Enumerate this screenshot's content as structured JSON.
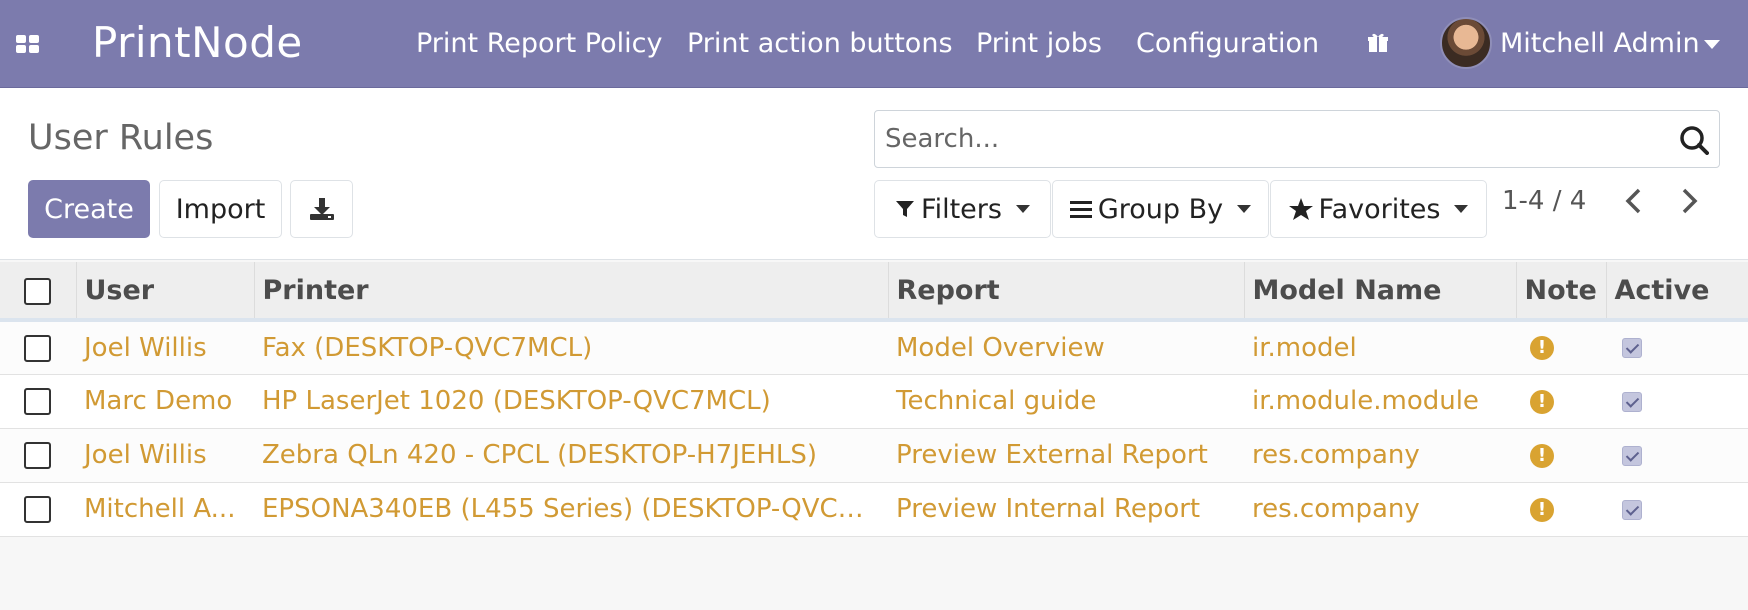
{
  "navbar": {
    "brand": "PrintNode",
    "menu": [
      "Print Report Policy",
      "Print action buttons",
      "Print jobs",
      "Configuration"
    ],
    "gift_icon": "gift-icon",
    "user_name": "Mitchell Admin"
  },
  "control_panel": {
    "title": "User Rules",
    "create_label": "Create",
    "import_label": "Import",
    "download_icon": "download-icon",
    "search_placeholder": "Search...",
    "filters_label": "Filters",
    "group_by_label": "Group By",
    "favorites_label": "Favorites",
    "pager": "1-4 / 4"
  },
  "table": {
    "columns": [
      "User",
      "Printer",
      "Report",
      "Model Name",
      "Note",
      "Active"
    ],
    "rows": [
      {
        "user": "Joel Willis",
        "printer": "Fax (DESKTOP-QVC7MCL)",
        "report": "Model Overview",
        "model": "ir.model",
        "active": true
      },
      {
        "user": "Marc Demo",
        "printer": "HP LaserJet 1020 (DESKTOP-QVC7MCL)",
        "report": "Technical guide",
        "model": "ir.module.module",
        "active": true
      },
      {
        "user": "Joel Willis",
        "printer": "Zebra QLn 420 - CPCL (DESKTOP-H7JEHLS)",
        "report": "Preview External Report",
        "model": "res.company",
        "active": true
      },
      {
        "user": "Mitchell A...",
        "printer": "EPSONA340EB (L455 Series) (DESKTOP-QVC7M...",
        "report": "Preview Internal Report",
        "model": "res.company",
        "active": true
      }
    ]
  },
  "colors": {
    "navbar": "#7c7bad",
    "link": "#d19a34",
    "note_icon": "#d9a331"
  }
}
